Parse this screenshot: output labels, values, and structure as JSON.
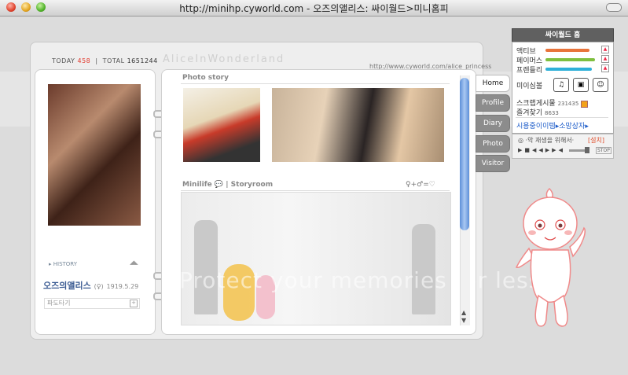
{
  "window": {
    "title": "http://minihp.cyworld.com - 오즈의앨리스: 싸이월드>미니홈피"
  },
  "counter": {
    "today_label": "TODAY",
    "today_value": "458",
    "total_label": "TOTAL",
    "total_value": "1651244"
  },
  "header": {
    "script_title": "AliceInWonderland",
    "url": "http://www.cyworld.com/alice_princess"
  },
  "left": {
    "history_label": "HISTORY",
    "owner_name": "오즈의앨리스",
    "owner_gender": "(♀)",
    "owner_birth": "1919.5.29",
    "wave_label": "파도타기"
  },
  "main": {
    "photo_story": "Photo story",
    "minilife": "Minilife",
    "storyroom": "Storyroom",
    "mood_formula": "♀+♂=♡"
  },
  "tabs": [
    "Home",
    "Profile",
    "Diary",
    "Photo",
    "Visitor"
  ],
  "panel": {
    "title": "싸이월드 홈",
    "stats": [
      {
        "label": "액티브",
        "color": "#e8743b",
        "level": 0.85
      },
      {
        "label": "페이머스",
        "color": "#7fbf3f",
        "level": 0.95
      },
      {
        "label": "프렌들리",
        "color": "#2fb0d8",
        "level": 0.9
      }
    ],
    "minimi_label": "미이심볼",
    "scrap_label": "스크랩게시물",
    "scrap_value": "231435",
    "fav_label": "즐겨찾기",
    "fav_value": "8633",
    "link_items": "시용중이이템",
    "link_wish": "소망상자"
  },
  "player": {
    "message": "·악 재생을 위해서·",
    "setup": "[설치]",
    "stop_label": "STOP"
  },
  "watermark": "Protect your memories for less!"
}
